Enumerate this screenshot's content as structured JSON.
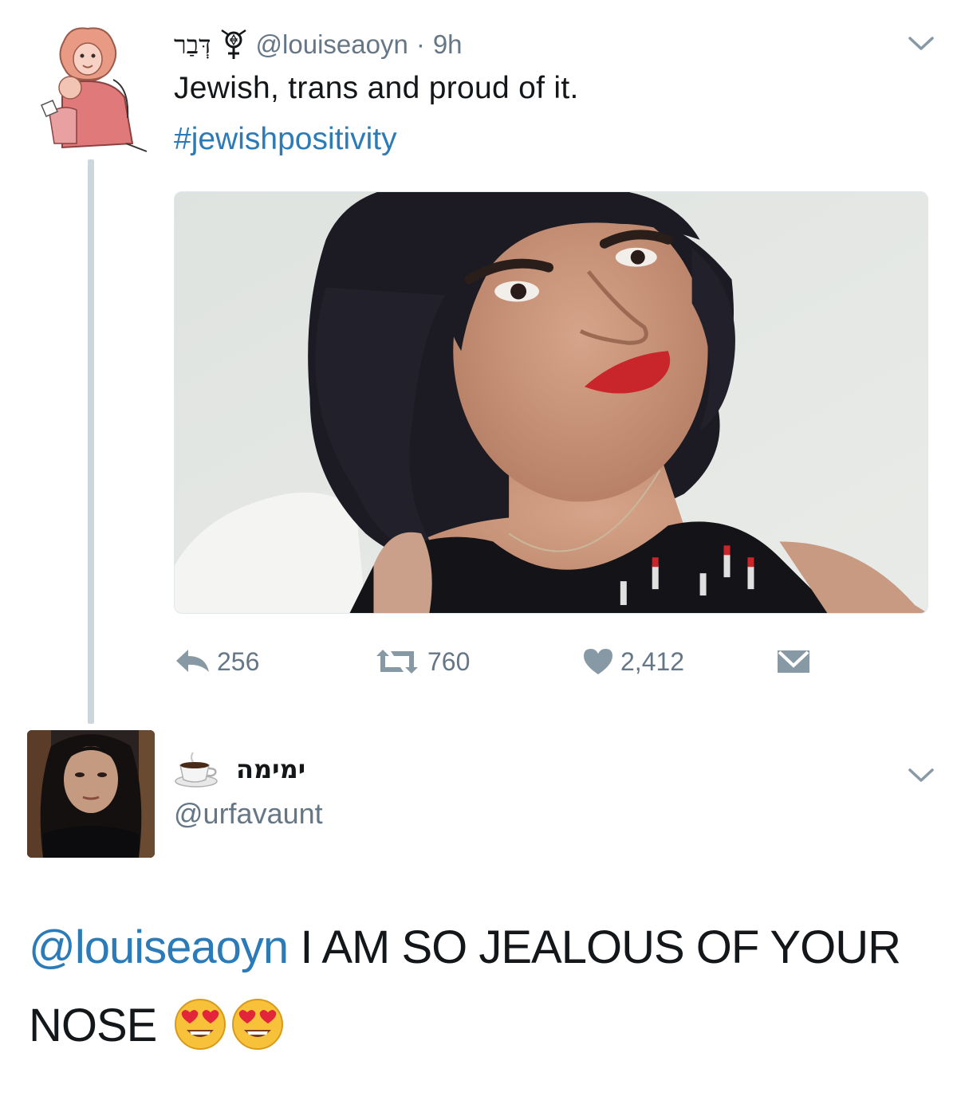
{
  "tweet": {
    "display_name": "דְּבַר",
    "symbol_icon": "jewish-trans-symbol-icon",
    "handle": "@louiseaoyn",
    "separator": "·",
    "time": "9h",
    "text": "Jewish, trans and proud of it.",
    "hashtag": "#jewishpositivity",
    "media_alt": "selfie photo",
    "stats": {
      "replies": "256",
      "retweets": "760",
      "likes": "2,412"
    }
  },
  "reply": {
    "display_name": "ימימה",
    "emoji_icon": "coffee-cup-icon",
    "handle": "@urfavaunt",
    "mention": "@louiseaoyn",
    "text_line1": " I AM SO JEALOUS OF YOUR",
    "text_line2": "NOSE",
    "emojis": [
      "heart-eyes-emoji",
      "heart-eyes-emoji"
    ]
  },
  "colors": {
    "text": "#14171a",
    "secondary": "#657786",
    "link": "#2b7bb9",
    "thread_line": "#ccd6dd"
  }
}
